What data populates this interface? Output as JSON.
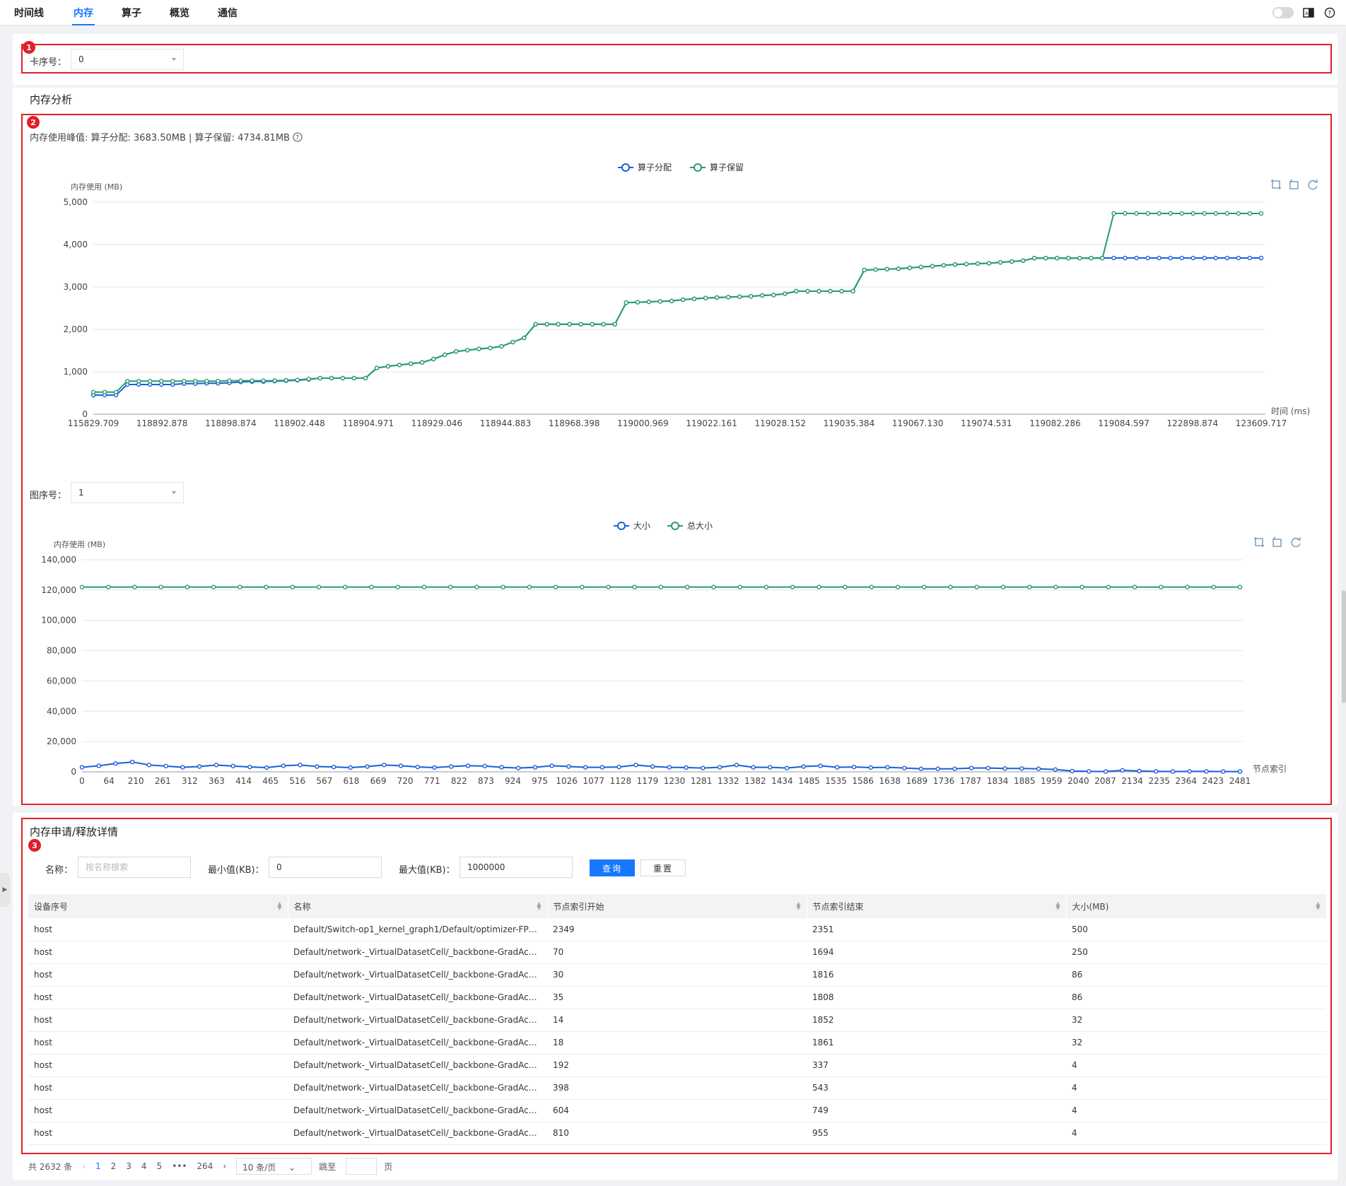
{
  "tabs": [
    {
      "label": "时间线",
      "active": false
    },
    {
      "label": "内存",
      "active": true
    },
    {
      "label": "算子",
      "active": false
    },
    {
      "label": "概览",
      "active": false
    },
    {
      "label": "通信",
      "active": false
    }
  ],
  "badges": [
    "1",
    "2",
    "3"
  ],
  "card_selector": {
    "label": "卡序号：",
    "value": "0"
  },
  "memory_analysis": {
    "title": "内存分析",
    "peak_text": "内存使用峰值: 算子分配: 3683.50MB | 算子保留: 4734.81MB",
    "help_icon": "question-circle-icon"
  },
  "graph_selector": {
    "label": "图序号：",
    "value": "1"
  },
  "chart_icons": [
    "zoom-select-icon",
    "zoom-reset-icon",
    "refresh-icon"
  ],
  "colors": {
    "blue": "#1a5fd8",
    "green": "#2a9a6e",
    "accent": "#1677ff",
    "highlight": "#e0202a"
  },
  "chart_data": [
    {
      "type": "line",
      "ylabel": "内存使用 (MB)",
      "xlabel": "时间 (ms)",
      "ylim": [
        0,
        5000
      ],
      "yticks": [
        "0",
        "1,000",
        "2,000",
        "3,000",
        "4,000",
        "5,000"
      ],
      "categories": [
        "115829.709",
        "118892.878",
        "118898.874",
        "118902.448",
        "118904.971",
        "118929.046",
        "118944.883",
        "118968.398",
        "119000.969",
        "119022.161",
        "119028.152",
        "119035.384",
        "119067.130",
        "119074.531",
        "119082.286",
        "119084.597",
        "122898.874",
        "123609.717"
      ],
      "legend": "top-center",
      "grid": true,
      "series": [
        {
          "name": "算子分配",
          "color": "#1a5fd8",
          "values": [
            450,
            450,
            450,
            700,
            700,
            700,
            700,
            700,
            720,
            720,
            730,
            730,
            740,
            760,
            770,
            770,
            780,
            790,
            800,
            820,
            850,
            850,
            850,
            850,
            850,
            1090,
            1130,
            1160,
            1190,
            1220,
            1300,
            1400,
            1480,
            1510,
            1540,
            1560,
            1600,
            1700,
            1800,
            2120,
            2120,
            2120,
            2120,
            2120,
            2120,
            2120,
            2120,
            2630,
            2640,
            2650,
            2660,
            2670,
            2700,
            2720,
            2740,
            2750,
            2760,
            2770,
            2780,
            2800,
            2810,
            2840,
            2900,
            2900,
            2900,
            2900,
            2900,
            2900,
            3400,
            3410,
            3420,
            3430,
            3450,
            3470,
            3490,
            3510,
            3530,
            3540,
            3550,
            3560,
            3580,
            3600,
            3620,
            3680,
            3680,
            3680,
            3680,
            3680,
            3680,
            3683,
            3683,
            3683,
            3683,
            3683,
            3683,
            3683,
            3683,
            3683,
            3683,
            3683,
            3683,
            3683,
            3683,
            3683
          ]
        },
        {
          "name": "算子保留",
          "color": "#2a9a6e",
          "values": [
            520,
            520,
            520,
            780,
            780,
            780,
            780,
            780,
            780,
            780,
            780,
            780,
            790,
            790,
            790,
            790,
            790,
            800,
            810,
            830,
            850,
            850,
            850,
            850,
            850,
            1090,
            1130,
            1160,
            1190,
            1220,
            1300,
            1400,
            1480,
            1510,
            1540,
            1560,
            1600,
            1700,
            1800,
            2120,
            2120,
            2120,
            2120,
            2120,
            2120,
            2120,
            2120,
            2630,
            2640,
            2650,
            2660,
            2670,
            2700,
            2720,
            2740,
            2750,
            2760,
            2770,
            2780,
            2800,
            2810,
            2840,
            2900,
            2900,
            2900,
            2900,
            2900,
            2900,
            3400,
            3410,
            3420,
            3430,
            3450,
            3470,
            3490,
            3510,
            3530,
            3540,
            3550,
            3560,
            3580,
            3600,
            3620,
            3680,
            3680,
            3680,
            3680,
            3680,
            3680,
            3680,
            4734,
            4734,
            4734,
            4734,
            4734,
            4734,
            4734,
            4734,
            4734,
            4734,
            4734,
            4734,
            4734,
            4734
          ]
        }
      ]
    },
    {
      "type": "line",
      "ylabel": "内存使用 (MB)",
      "xlabel": "节点索引",
      "ylim": [
        0,
        140000
      ],
      "yticks": [
        "0",
        "20,000",
        "40,000",
        "60,000",
        "80,000",
        "100,000",
        "120,000",
        "140,000"
      ],
      "categories": [
        "0",
        "64",
        "210",
        "261",
        "312",
        "363",
        "414",
        "465",
        "516",
        "567",
        "618",
        "669",
        "720",
        "771",
        "822",
        "873",
        "924",
        "975",
        "1026",
        "1077",
        "1128",
        "1179",
        "1230",
        "1281",
        "1332",
        "1382",
        "1434",
        "1485",
        "1535",
        "1586",
        "1638",
        "1689",
        "1736",
        "1787",
        "1834",
        "1885",
        "1959",
        "2040",
        "2087",
        "2134",
        "2235",
        "2364",
        "2423",
        "2481"
      ],
      "legend": "top-center",
      "grid": true,
      "series": [
        {
          "name": "大小",
          "color": "#1a5fd8",
          "values": [
            3000,
            4000,
            5500,
            6500,
            4500,
            3800,
            3000,
            3500,
            4500,
            3800,
            3200,
            2800,
            4000,
            4500,
            3500,
            3200,
            2800,
            3500,
            4500,
            4000,
            3200,
            2800,
            3500,
            4000,
            3800,
            3000,
            2500,
            3000,
            4000,
            3500,
            3000,
            3000,
            3200,
            4500,
            3500,
            3000,
            2800,
            2500,
            3000,
            4500,
            3000,
            3000,
            2500,
            3500,
            4000,
            3000,
            3200,
            2800,
            3000,
            2500,
            2000,
            2000,
            2000,
            2500,
            2500,
            2200,
            2200,
            2000,
            1500,
            500,
            300,
            200,
            1000,
            500,
            300,
            200,
            300,
            300,
            200,
            200
          ]
        },
        {
          "name": "总大小",
          "color": "#2a9a6e",
          "values": [
            122000,
            122000,
            122000,
            122000,
            122000,
            122000,
            122000,
            122000,
            122000,
            122000,
            122000,
            122000,
            122000,
            122000,
            122000,
            122000,
            122000,
            122000,
            122000,
            122000,
            122000,
            122000,
            122000,
            122000,
            122000,
            122000,
            122000,
            122000,
            122000,
            122000,
            122000,
            122000,
            122000,
            122000,
            122000,
            122000,
            122000,
            122000,
            122000,
            122000,
            122000,
            122000,
            122000,
            122000,
            122000
          ]
        }
      ]
    }
  ],
  "details": {
    "title": "内存申请/释放详情",
    "name_label": "名称：",
    "name_placeholder": "按名称搜索",
    "min_label": "最小值(KB)：",
    "min_value": "0",
    "max_label": "最大值(KB)：",
    "max_value": "1000000",
    "query_button": "查询",
    "reset_button": "重置",
    "columns": [
      "设备序号",
      "名称",
      "节点索引开始",
      "节点索引结束",
      "大小(MB)"
    ],
    "rows": [
      [
        "host",
        "Default/Switch-op1_kernel_graph1/Default/optimizer-FP32...",
        "2349",
        "2351",
        "500"
      ],
      [
        "host",
        "Default/network-_VirtualDatasetCell/_backbone-GradAccu...",
        "70",
        "1694",
        "250"
      ],
      [
        "host",
        "Default/network-_VirtualDatasetCell/_backbone-GradAccu...",
        "30",
        "1816",
        "86"
      ],
      [
        "host",
        "Default/network-_VirtualDatasetCell/_backbone-GradAccu...",
        "35",
        "1808",
        "86"
      ],
      [
        "host",
        "Default/network-_VirtualDatasetCell/_backbone-GradAccu...",
        "14",
        "1852",
        "32"
      ],
      [
        "host",
        "Default/network-_VirtualDatasetCell/_backbone-GradAccu...",
        "18",
        "1861",
        "32"
      ],
      [
        "host",
        "Default/network-_VirtualDatasetCell/_backbone-GradAccu...",
        "192",
        "337",
        "4"
      ],
      [
        "host",
        "Default/network-_VirtualDatasetCell/_backbone-GradAccu...",
        "398",
        "543",
        "4"
      ],
      [
        "host",
        "Default/network-_VirtualDatasetCell/_backbone-GradAccu...",
        "604",
        "749",
        "4"
      ],
      [
        "host",
        "Default/network-_VirtualDatasetCell/_backbone-GradAccu...",
        "810",
        "955",
        "4"
      ]
    ]
  },
  "pagination": {
    "total": "共 2632 条",
    "pages": [
      "1",
      "2",
      "3",
      "4",
      "5",
      "•••",
      "264"
    ],
    "current": "1",
    "page_size": "10 条/页",
    "jump_label": "跳至",
    "page_suffix": "页"
  }
}
